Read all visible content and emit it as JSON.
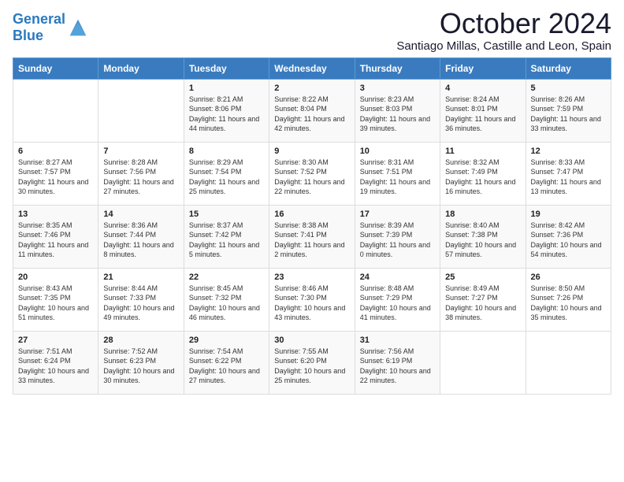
{
  "header": {
    "logo_line1": "General",
    "logo_line2": "Blue",
    "month": "October 2024",
    "location": "Santiago Millas, Castille and Leon, Spain"
  },
  "days_of_week": [
    "Sunday",
    "Monday",
    "Tuesday",
    "Wednesday",
    "Thursday",
    "Friday",
    "Saturday"
  ],
  "weeks": [
    [
      {
        "day": "",
        "text": ""
      },
      {
        "day": "",
        "text": ""
      },
      {
        "day": "1",
        "text": "Sunrise: 8:21 AM\nSunset: 8:06 PM\nDaylight: 11 hours and 44 minutes."
      },
      {
        "day": "2",
        "text": "Sunrise: 8:22 AM\nSunset: 8:04 PM\nDaylight: 11 hours and 42 minutes."
      },
      {
        "day": "3",
        "text": "Sunrise: 8:23 AM\nSunset: 8:03 PM\nDaylight: 11 hours and 39 minutes."
      },
      {
        "day": "4",
        "text": "Sunrise: 8:24 AM\nSunset: 8:01 PM\nDaylight: 11 hours and 36 minutes."
      },
      {
        "day": "5",
        "text": "Sunrise: 8:26 AM\nSunset: 7:59 PM\nDaylight: 11 hours and 33 minutes."
      }
    ],
    [
      {
        "day": "6",
        "text": "Sunrise: 8:27 AM\nSunset: 7:57 PM\nDaylight: 11 hours and 30 minutes."
      },
      {
        "day": "7",
        "text": "Sunrise: 8:28 AM\nSunset: 7:56 PM\nDaylight: 11 hours and 27 minutes."
      },
      {
        "day": "8",
        "text": "Sunrise: 8:29 AM\nSunset: 7:54 PM\nDaylight: 11 hours and 25 minutes."
      },
      {
        "day": "9",
        "text": "Sunrise: 8:30 AM\nSunset: 7:52 PM\nDaylight: 11 hours and 22 minutes."
      },
      {
        "day": "10",
        "text": "Sunrise: 8:31 AM\nSunset: 7:51 PM\nDaylight: 11 hours and 19 minutes."
      },
      {
        "day": "11",
        "text": "Sunrise: 8:32 AM\nSunset: 7:49 PM\nDaylight: 11 hours and 16 minutes."
      },
      {
        "day": "12",
        "text": "Sunrise: 8:33 AM\nSunset: 7:47 PM\nDaylight: 11 hours and 13 minutes."
      }
    ],
    [
      {
        "day": "13",
        "text": "Sunrise: 8:35 AM\nSunset: 7:46 PM\nDaylight: 11 hours and 11 minutes."
      },
      {
        "day": "14",
        "text": "Sunrise: 8:36 AM\nSunset: 7:44 PM\nDaylight: 11 hours and 8 minutes."
      },
      {
        "day": "15",
        "text": "Sunrise: 8:37 AM\nSunset: 7:42 PM\nDaylight: 11 hours and 5 minutes."
      },
      {
        "day": "16",
        "text": "Sunrise: 8:38 AM\nSunset: 7:41 PM\nDaylight: 11 hours and 2 minutes."
      },
      {
        "day": "17",
        "text": "Sunrise: 8:39 AM\nSunset: 7:39 PM\nDaylight: 11 hours and 0 minutes."
      },
      {
        "day": "18",
        "text": "Sunrise: 8:40 AM\nSunset: 7:38 PM\nDaylight: 10 hours and 57 minutes."
      },
      {
        "day": "19",
        "text": "Sunrise: 8:42 AM\nSunset: 7:36 PM\nDaylight: 10 hours and 54 minutes."
      }
    ],
    [
      {
        "day": "20",
        "text": "Sunrise: 8:43 AM\nSunset: 7:35 PM\nDaylight: 10 hours and 51 minutes."
      },
      {
        "day": "21",
        "text": "Sunrise: 8:44 AM\nSunset: 7:33 PM\nDaylight: 10 hours and 49 minutes."
      },
      {
        "day": "22",
        "text": "Sunrise: 8:45 AM\nSunset: 7:32 PM\nDaylight: 10 hours and 46 minutes."
      },
      {
        "day": "23",
        "text": "Sunrise: 8:46 AM\nSunset: 7:30 PM\nDaylight: 10 hours and 43 minutes."
      },
      {
        "day": "24",
        "text": "Sunrise: 8:48 AM\nSunset: 7:29 PM\nDaylight: 10 hours and 41 minutes."
      },
      {
        "day": "25",
        "text": "Sunrise: 8:49 AM\nSunset: 7:27 PM\nDaylight: 10 hours and 38 minutes."
      },
      {
        "day": "26",
        "text": "Sunrise: 8:50 AM\nSunset: 7:26 PM\nDaylight: 10 hours and 35 minutes."
      }
    ],
    [
      {
        "day": "27",
        "text": "Sunrise: 7:51 AM\nSunset: 6:24 PM\nDaylight: 10 hours and 33 minutes."
      },
      {
        "day": "28",
        "text": "Sunrise: 7:52 AM\nSunset: 6:23 PM\nDaylight: 10 hours and 30 minutes."
      },
      {
        "day": "29",
        "text": "Sunrise: 7:54 AM\nSunset: 6:22 PM\nDaylight: 10 hours and 27 minutes."
      },
      {
        "day": "30",
        "text": "Sunrise: 7:55 AM\nSunset: 6:20 PM\nDaylight: 10 hours and 25 minutes."
      },
      {
        "day": "31",
        "text": "Sunrise: 7:56 AM\nSunset: 6:19 PM\nDaylight: 10 hours and 22 minutes."
      },
      {
        "day": "",
        "text": ""
      },
      {
        "day": "",
        "text": ""
      }
    ]
  ]
}
